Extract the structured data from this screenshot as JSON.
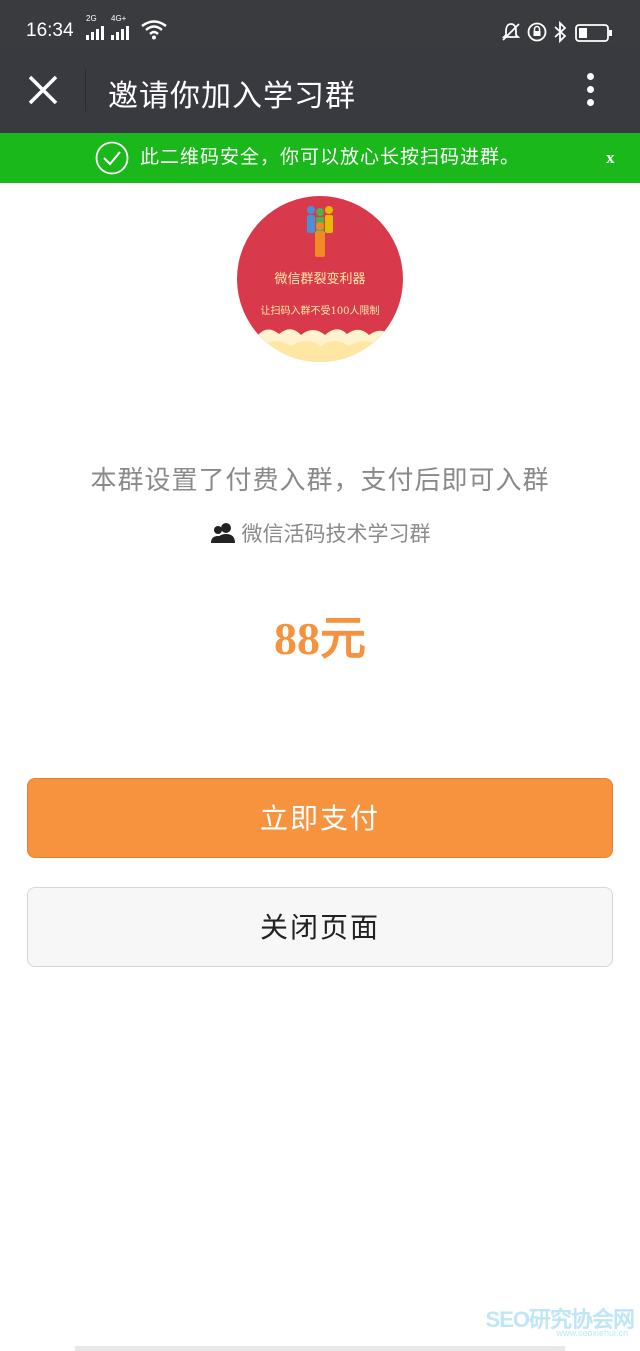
{
  "status_bar": {
    "time": "16:34",
    "signal1_tag": "2G",
    "signal2_tag": "4G+"
  },
  "title_bar": {
    "title": "邀请你加入学习群"
  },
  "banner": {
    "text": "此二维码安全，你可以放心长按扫码进群。",
    "close_label": "x"
  },
  "avatar": {
    "line1": "微信群裂变利器",
    "line2": "让扫码入群不受100人限制"
  },
  "main": {
    "info_text": "本群设置了付费入群，支付后即可入群",
    "group_name": "微信活码技术学习群",
    "price": "88元"
  },
  "buttons": {
    "pay_label": "立即支付",
    "close_label": "关闭页面"
  },
  "watermark": {
    "text": "SEO研究协会网",
    "sub": "www.seoxiehui.cn"
  },
  "colors": {
    "banner_green": "#1ab81a",
    "accent_orange": "#f7933e",
    "title_bar": "#393a3f"
  }
}
